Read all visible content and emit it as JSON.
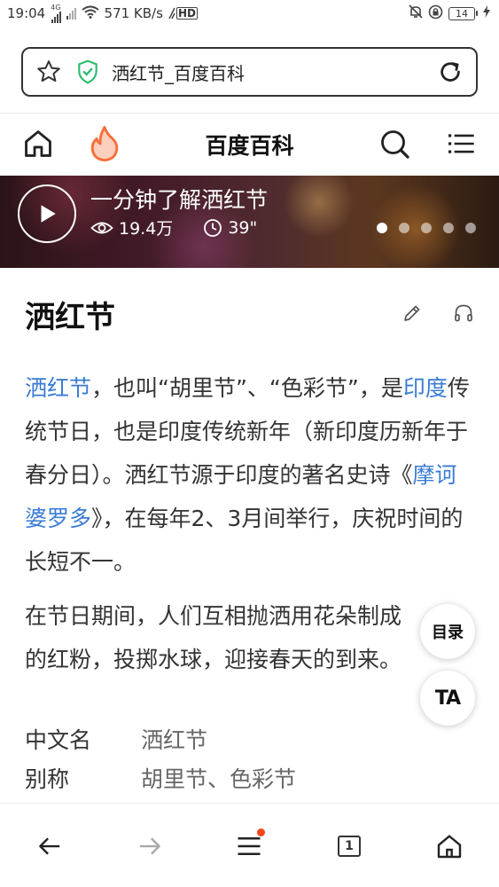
{
  "status_bar": {
    "time": "19:04",
    "network_label": "4G",
    "speed": "571 KB/s",
    "hd_label": "HD",
    "battery": "14"
  },
  "url_bar": {
    "text": "洒红节_百度百科"
  },
  "header": {
    "site_title": "百度百科"
  },
  "banner": {
    "title": "一分钟了解洒红节",
    "views": "19.4万",
    "duration": "39\"",
    "slide_count": 5,
    "active_slide": 1
  },
  "article": {
    "title": "洒红节",
    "para1": [
      {
        "text": "洒红节",
        "link": true
      },
      {
        "text": "，也叫“胡里节”、“色彩节”，是",
        "link": false
      },
      {
        "text": "印度",
        "link": true
      },
      {
        "text": "传统节日，也是印度传统新年（新印度历新年于春分日）。洒红节源于印度的著名史诗《",
        "link": false
      },
      {
        "text": "摩诃婆罗多",
        "link": true
      },
      {
        "text": "》，在每年2、3月间举行，庆祝时间的长短不一。",
        "link": false
      }
    ],
    "para2": "在节日期间，人们互相抛洒用花朵制成的红粉，投掷水球，迎接春天的到来。",
    "info": [
      {
        "key": "中文名",
        "value": "洒红节"
      },
      {
        "key": "别称",
        "value": "胡里节、色彩节"
      }
    ]
  },
  "floating": {
    "toc_label": "目录",
    "ta_label": "TA"
  },
  "bottom_nav": {
    "tab_count": "1"
  },
  "colors": {
    "link": "#3a7bd5",
    "shield_green": "#2dbd6e",
    "fire_orange": "#f5703a",
    "notification_red": "#f5451c"
  }
}
